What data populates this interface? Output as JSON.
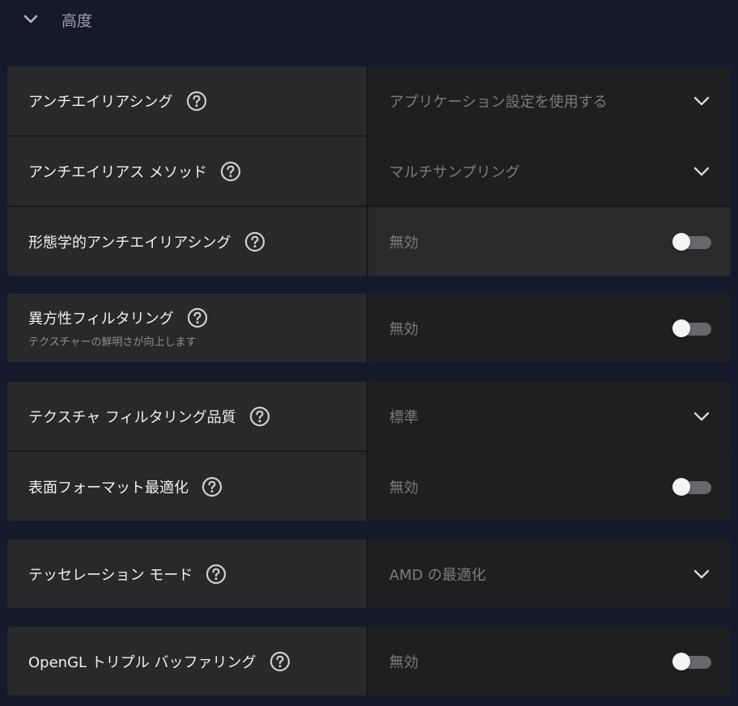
{
  "section": {
    "title": "高度"
  },
  "groups": [
    {
      "rows": [
        {
          "label": "アンチエイリアシング",
          "value": "アプリケーション設定を使用する",
          "control": "dropdown"
        },
        {
          "label": "アンチエイリアス メソッド",
          "value": "マルチサンプリング",
          "control": "dropdown"
        },
        {
          "label": "形態学的アンチエイリアシング",
          "value": "無効",
          "control": "toggle",
          "on": false
        }
      ]
    },
    {
      "rows": [
        {
          "label": "異方性フィルタリング",
          "sublabel": "テクスチャーの鮮明さが向上します",
          "value": "無効",
          "control": "toggle",
          "on": false
        }
      ]
    },
    {
      "rows": [
        {
          "label": "テクスチャ フィルタリング品質",
          "value": "標準",
          "control": "dropdown"
        },
        {
          "label": "表面フォーマット最適化",
          "value": "無効",
          "control": "toggle",
          "on": false
        }
      ]
    },
    {
      "rows": [
        {
          "label": "テッセレーション モード",
          "value": "AMD の最適化",
          "control": "dropdown"
        }
      ]
    },
    {
      "rows": [
        {
          "label": "OpenGL トリプル バッファリング",
          "value": "無効",
          "control": "toggle",
          "on": false
        }
      ]
    }
  ],
  "colors": {
    "background": "#141a2c",
    "label_cell": "#29292b",
    "value_cell": "#1f1f21",
    "toggle_track_off": "#68686c",
    "toggle_knob": "#f4f4f4"
  },
  "icons": {
    "section_toggle": "chevron-down-icon",
    "help": "help-circle-icon",
    "dropdown": "chevron-down-icon"
  }
}
